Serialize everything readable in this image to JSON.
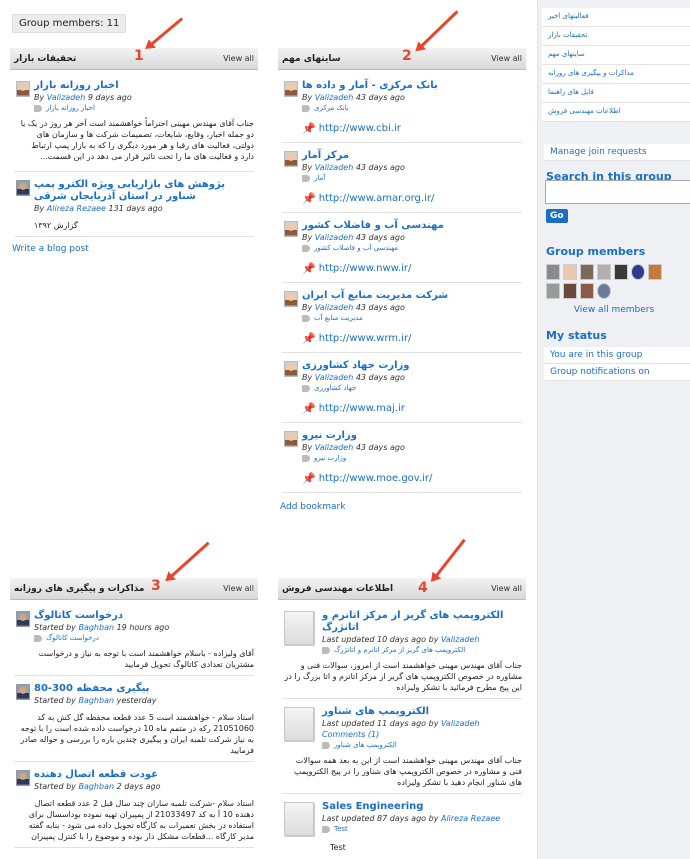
{
  "group_members_badge": "Group members: 11",
  "view_all": "View all",
  "panels": {
    "research": {
      "title": "تحقیقات بازار",
      "items": [
        {
          "title": "اخبار روزانه بازار",
          "by": "By",
          "author": "Valizadeh",
          "ago": "9 days ago",
          "tag": "اخبار روزانه بازار",
          "text": "جناب آقای مهندس مهینی احتراماً خواهشمند است آخر هر روز در یک یا دو جمله اخبار، وقایع، شایعات، تصمیمات شرکت ها و سازمان های دولتی، فعالیت های رقبا و هر مورد دیگری را که به بازار پمپ ارتباط دارد و فعالیت های ما را تحت تاثیر قرار می دهد در این قسمت..."
        },
        {
          "title": "پژوهش های بازاریابی ویژه الکترو پمپ شناور در استان آذربایجان شرقی",
          "by": "By",
          "author": "Alireza Rezaee",
          "ago": "131 days ago",
          "text": "گزارش ۱۳۹۲"
        }
      ],
      "footer": "Write a blog post"
    },
    "sites": {
      "title": "سایتهای مهم",
      "items": [
        {
          "title": "بانک مرکزی - آمار و داده ها",
          "by": "By",
          "author": "Valizadeh",
          "ago": "43 days ago",
          "tag": "بانک مرکزی",
          "url": "http://www.cbi.ir"
        },
        {
          "title": "مرکز آمار",
          "by": "By",
          "author": "Valizadeh",
          "ago": "43 days ago",
          "tag": "آمار",
          "url": "http://www.amar.org.ir/"
        },
        {
          "title": "مهندسی آب و فاضلاب کشور",
          "by": "By",
          "author": "Valizadeh",
          "ago": "43 days ago",
          "tag": "مهندسی آب و فاضلاب کشور",
          "url": "http://www.nww.ir/"
        },
        {
          "title": "شرکت مدیریت منابع آب ایران",
          "by": "By",
          "author": "Valizadeh",
          "ago": "43 days ago",
          "tag": "مدیریت منابع آب",
          "url": "http://www.wrm.ir/"
        },
        {
          "title": "وزارت جهاد کشاورزی",
          "by": "By",
          "author": "Valizadeh",
          "ago": "43 days ago",
          "tag": "جهاد کشاورزی",
          "url": "http://www.maj.ir"
        },
        {
          "title": "وزارت نیرو",
          "by": "By",
          "author": "Valizadeh",
          "ago": "43 days ago",
          "tag": "وزارت نیرو",
          "url": "http://www.moe.gov.ir/"
        }
      ],
      "footer": "Add bookmark"
    },
    "discussions": {
      "title": "مذاکرات و پیگیری های روزانه",
      "items": [
        {
          "title": "درخواست کاتالوگ",
          "started": "Started by",
          "author": "Baghban",
          "ago": "19 hours ago",
          "tag": "درخواست کاتالوگ",
          "text": "آقای ولیزاده - باسلام خواهشمند است با توجه به نیاز و درخواست مشتریان تعدادی کاتالوگ تحویل فرمایید"
        },
        {
          "title": "پیگیری محفظه 300-80",
          "started": "Started by",
          "author": "Baghban",
          "ago": "yesterday",
          "text": "استاد سلام - خواهشمند است 5 عدد قطعه محفظه گل کش به کد 21051060 رکه در متمم ماه 10 درخواست داده شده است را با توجه به نیاز شرکت تلمبه ایران و پیگیری چندین باره را بررسی و حواله صادر فرمایید"
        },
        {
          "title": "عودت قطعه اتصال دهنده",
          "started": "Started by",
          "author": "Baghban",
          "ago": "2 days ago",
          "text": "استاد سلام -شرکت تلمبه سازان چند سال قبل 2 عدد قطعه اتصال دهنده 10 آ به کد 21033497 از پمپیران تهیه نموده بوداسسال برای استفاده در بخش تعمیرات به کارگاه تحویل داده می شود - بنابه گفته مدیر کارگاه ...قطعات مشکل دار بوده و موضوع را با کنترل پمپیران"
        }
      ]
    },
    "sales": {
      "title": "اطلاعات مهندسی فروش",
      "items": [
        {
          "title": "الکتروپمپ های گریز از مرکز اتانرم و اتانژرگ",
          "updated": "Last updated",
          "ago": "10 days ago",
          "by": "by",
          "author": "Valizadeh",
          "tag": "الکتروپمپ های گریز از مرکز اتانرم و اتانژرگ",
          "text": "جناب آقای مهندس مهینی خواهشمند است از امروز، سوالات فنی و مشاوره در خصوص الکتروپمپ های گریز از مرکز اتانرم و اتا بزرگ را در این پیج مطرح فرمائید با تشکر ولیزاده"
        },
        {
          "title": "الکتروپمپ های شناور",
          "updated": "Last updated",
          "ago": "11 days ago",
          "by": "by",
          "author": "Valizadeh",
          "comments": "Comments (1)",
          "tag": "الکتروپمپ های شناور",
          "text": "جناب آقای مهندس مهینی خواهشمند است از این به بعد همه سوالات فنی و مشاوره در خصوص الکتروپمپ های شناور را در پیج الکتروپمپ های شناور انجام دهید با تشکر ولیزاده"
        },
        {
          "title": "Sales Engineering",
          "updated": "Last updated",
          "ago": "87 days ago",
          "by": "by",
          "author": "Alireza Rezaee",
          "tag": "Test",
          "text": "Test"
        }
      ]
    }
  },
  "annotations": [
    "1",
    "2",
    "3",
    "4"
  ],
  "sidebar": {
    "menu": [
      "فعالیتهای اخیر",
      "تحقیقات بازار",
      "سایتهای مهم",
      "مذاکرات و پیگیری های روزانه",
      "فایل های راهنما",
      "اطلاعات مهندسی فروش"
    ],
    "manage": "Manage join requests",
    "search_title": "Search in this group",
    "go": "Go",
    "members_title": "Group members",
    "view_all_members": "View all members",
    "status_title": "My status",
    "status_items": [
      "You are in this group",
      "Group notifications on"
    ]
  },
  "colors": {
    "link": "#1a6fc4",
    "annotation": "#e8452a",
    "sidebar_bg": "#eef0f3"
  }
}
